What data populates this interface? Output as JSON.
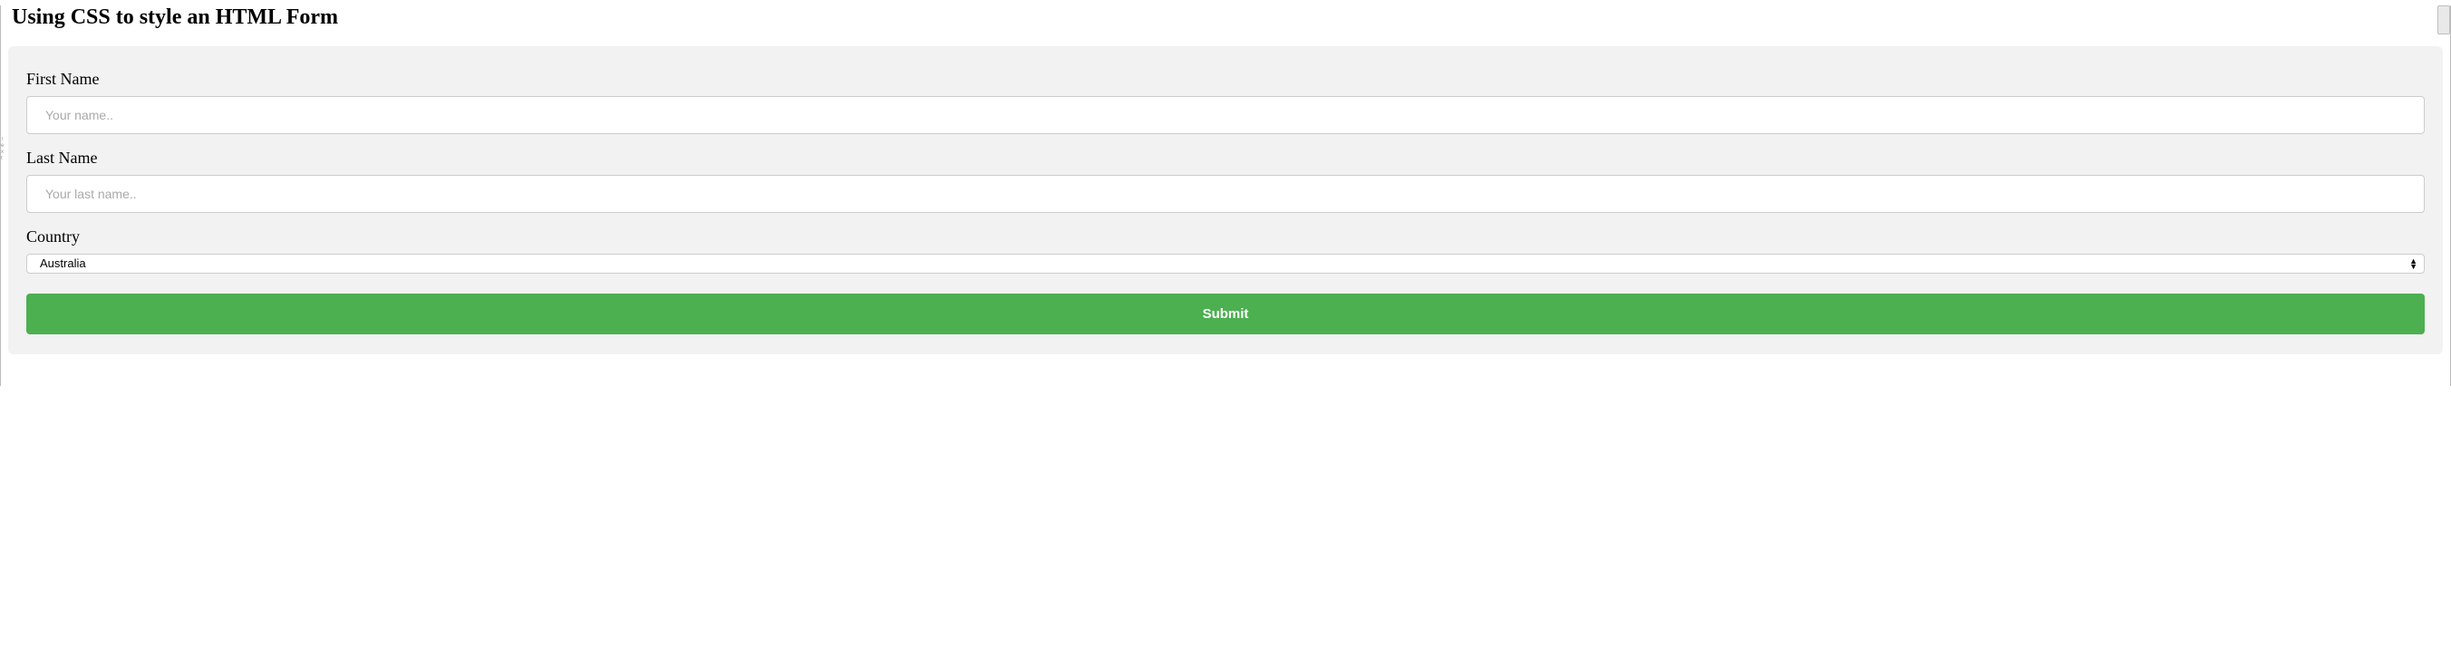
{
  "page_title": "Using CSS to style an HTML Form",
  "form": {
    "first_name": {
      "label": "First Name",
      "placeholder": "Your name..",
      "value": ""
    },
    "last_name": {
      "label": "Last Name",
      "placeholder": "Your last name..",
      "value": ""
    },
    "country": {
      "label": "Country",
      "selected": "Australia"
    },
    "submit_label": "Submit"
  },
  "colors": {
    "form_bg": "#f2f2f2",
    "button_bg": "#4CAF50",
    "input_border": "#cccccc",
    "placeholder": "#aaaaaa"
  }
}
